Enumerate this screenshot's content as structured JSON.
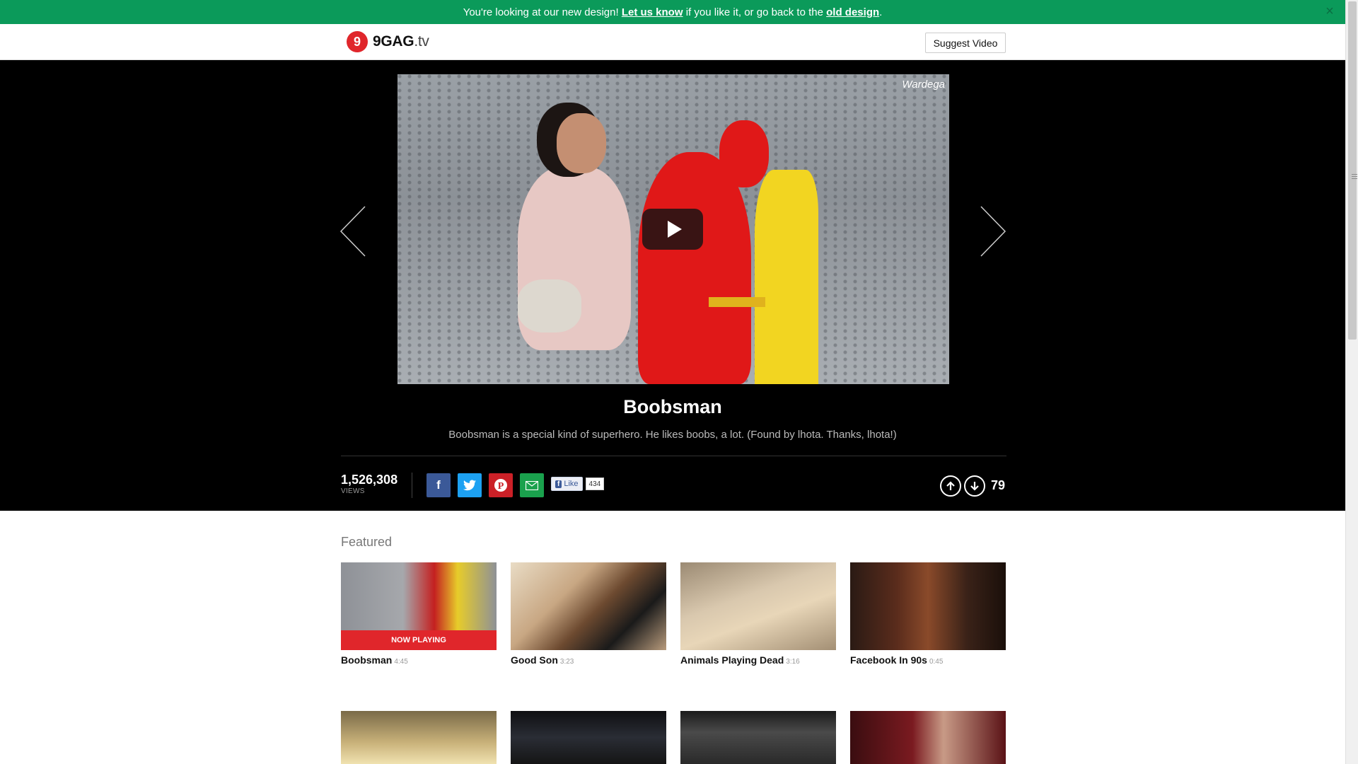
{
  "notice": {
    "text_before": "You're looking at our new design!",
    "link1": "Let us know",
    "text_middle": "if you like it, or go back to the",
    "link2": "old design",
    "text_after": ".",
    "close": "×"
  },
  "header": {
    "logo_mark": "9",
    "logo_name": "9GAG",
    "logo_tld": ".tv",
    "suggest_label": "Suggest Video"
  },
  "video": {
    "watermark": "Wardega",
    "title": "Boobsman",
    "description": "Boobsman is a special kind of superhero. He likes boobs, a lot. (Found by lhota. Thanks, lhota!)",
    "views": "1,526,308",
    "views_label": "VIEWS",
    "fb_like_label": "Like",
    "fb_like_count": "434",
    "score": "79"
  },
  "featured": {
    "title": "Featured",
    "now_playing_label": "NOW PLAYING",
    "items": [
      {
        "title": "Boobsman",
        "duration": "4:45"
      },
      {
        "title": "Good Son",
        "duration": "3:23"
      },
      {
        "title": "Animals Playing Dead",
        "duration": "3:16"
      },
      {
        "title": "Facebook In 90s",
        "duration": "0:45"
      }
    ]
  },
  "colors": {
    "banner": "#0b9a5a",
    "brand_red": "#e0262b",
    "stage": "#000000"
  }
}
